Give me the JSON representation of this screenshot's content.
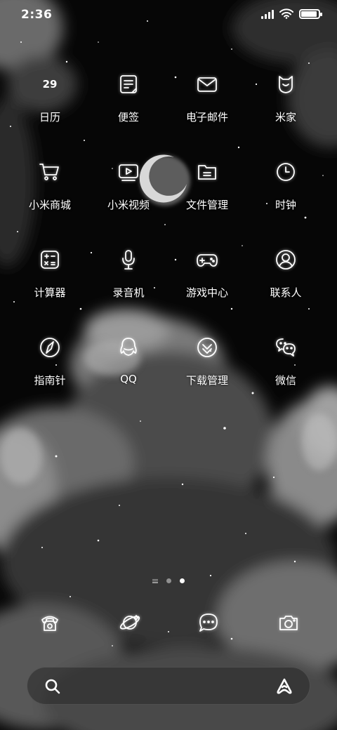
{
  "status_bar": {
    "time": "2:36",
    "battery_level": 0.9,
    "signal_bars": 4,
    "icons": [
      "signal-icon",
      "wifi-icon",
      "battery-icon"
    ]
  },
  "apps": [
    {
      "label": "日历",
      "icon": "calendar-icon",
      "calendar_day": "29"
    },
    {
      "label": "便签",
      "icon": "notes-icon"
    },
    {
      "label": "电子邮件",
      "icon": "mail-icon"
    },
    {
      "label": "米家",
      "icon": "mijia-icon"
    },
    {
      "label": "小米商城",
      "icon": "shopping-cart-icon"
    },
    {
      "label": "小米视频",
      "icon": "video-player-icon"
    },
    {
      "label": "文件管理",
      "icon": "folder-icon"
    },
    {
      "label": "时钟",
      "icon": "clock-icon"
    },
    {
      "label": "计算器",
      "icon": "calculator-icon"
    },
    {
      "label": "录音机",
      "icon": "microphone-icon"
    },
    {
      "label": "游戏中心",
      "icon": "gamepad-icon"
    },
    {
      "label": "联系人",
      "icon": "contact-icon"
    },
    {
      "label": "指南针",
      "icon": "compass-icon"
    },
    {
      "label": "QQ",
      "icon": "qq-penguin-icon"
    },
    {
      "label": "下载管理",
      "icon": "download-icon"
    },
    {
      "label": "微信",
      "icon": "wechat-icon"
    }
  ],
  "page_indicator": {
    "pages": 2,
    "active_page": 2
  },
  "dock": [
    {
      "icon": "phone-icon"
    },
    {
      "icon": "planet-browser-icon"
    },
    {
      "icon": "message-bubble-icon"
    },
    {
      "icon": "camera-icon"
    }
  ],
  "search_bar": {
    "left_icon": "search-icon",
    "right_icon": "xiaoai-assistant-icon"
  },
  "colors": {
    "wallpaper": "#050505",
    "icon_stroke": "#ffffff",
    "label": "#ffffff"
  }
}
